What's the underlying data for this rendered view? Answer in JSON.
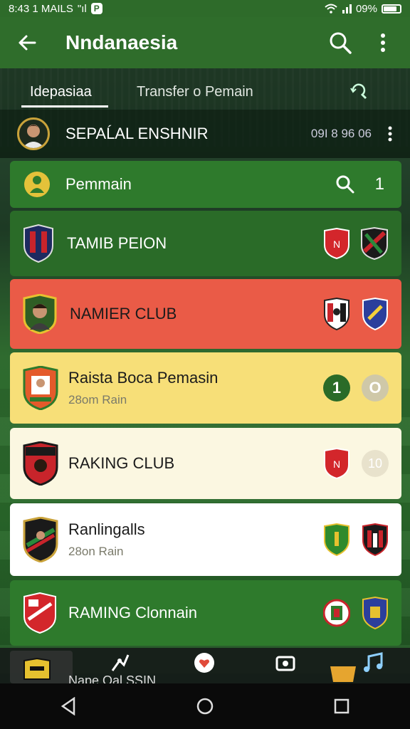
{
  "status_bar": {
    "time_text": "8:43 1 MAILS",
    "signal_text": "\"ıl",
    "app_badge": "P",
    "battery_text": "09%"
  },
  "app_bar": {
    "title": "Nndanaesia"
  },
  "tabs": [
    {
      "label": "Idepasiaa"
    },
    {
      "label": "Transfer o Pemain"
    }
  ],
  "featured": {
    "name": "SEPAĹAL ENSHNIR",
    "score": "09I 8 96 06"
  },
  "rows": [
    {
      "label": "Pemmain",
      "count": "1",
      "bg": "#2e7a2c"
    },
    {
      "label": "TAMIB PEION",
      "bg": "#2a6b28"
    },
    {
      "label": "NAMIER CLUB",
      "bg": "#ea5b47"
    },
    {
      "label": "Raista Boca Pemasin",
      "sub": "28om Rain",
      "badge1": "1",
      "badge2": "O",
      "bg": "#f7df78"
    },
    {
      "label": "RAKING CLUB",
      "badge2": "10",
      "bg": "#fbf7e1"
    },
    {
      "label": "Ranlingalls",
      "sub": "28on Rain",
      "bg": "#ffffff"
    },
    {
      "label": "RAMING Clonnain",
      "bg": "#2e7a2c"
    }
  ],
  "bottom_tabs": {
    "partial_label": "Nape Oal SSIN"
  },
  "colors": {
    "primary": "#2f6d2b",
    "red_row": "#ea5b47",
    "yellow_row": "#f7df78",
    "cream_row": "#fbf7e1"
  }
}
